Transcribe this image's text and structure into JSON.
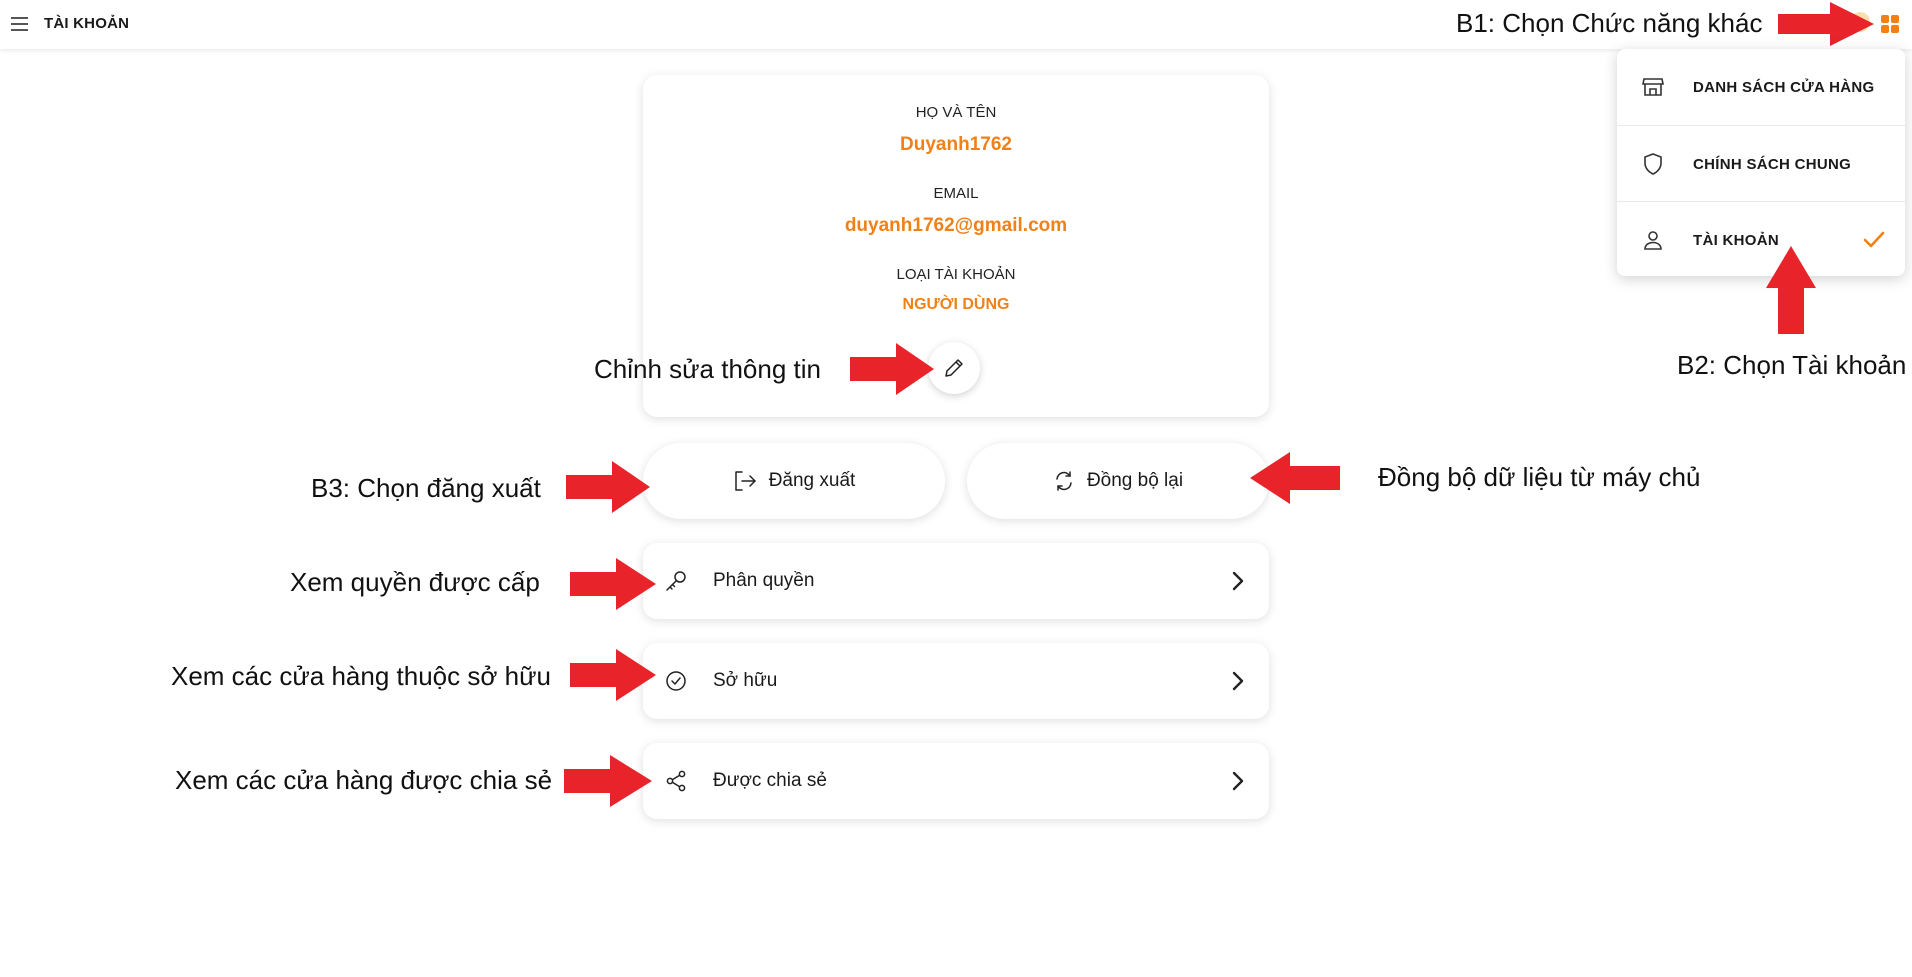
{
  "header": {
    "title": "TÀI KHOẢN"
  },
  "dropdown_menu": {
    "items": [
      {
        "label": "DANH SÁCH CỬA HÀNG",
        "icon": "store-icon"
      },
      {
        "label": "CHÍNH SÁCH CHUNG",
        "icon": "shield-icon"
      },
      {
        "label": "TÀI KHOẢN",
        "icon": "user-icon",
        "selected": true
      }
    ]
  },
  "profile": {
    "name_label": "HỌ VÀ TÊN",
    "name_value": "Duyanh1762",
    "email_label": "EMAIL",
    "email_value": "duyanh1762@gmail.com",
    "type_label": "LOẠI TÀI KHOẢN",
    "type_value": "NGƯỜI DÙNG"
  },
  "actions": {
    "logout_label": "Đăng xuất",
    "sync_label": "Đồng bộ lại"
  },
  "rows": [
    {
      "label": "Phân quyền",
      "icon": "key-icon"
    },
    {
      "label": "Sở hữu",
      "icon": "check-circle-icon"
    },
    {
      "label": "Được chia sẻ",
      "icon": "share-icon"
    }
  ],
  "annotations": {
    "b1": "B1: Chọn Chức năng khác",
    "b2": "B2: Chọn Tài khoản",
    "b3": "B3: Chọn đăng xuất",
    "edit": "Chỉnh sửa thông tin",
    "sync": "Đồng bộ dữ liệu từ máy chủ",
    "permissions": "Xem quyền được cấp",
    "owned": "Xem các cửa hàng thuộc sở hữu",
    "shared": "Xem các cửa hàng được chia sẻ"
  },
  "colors": {
    "accent": "#f08118",
    "arrow": "#e8232a"
  }
}
